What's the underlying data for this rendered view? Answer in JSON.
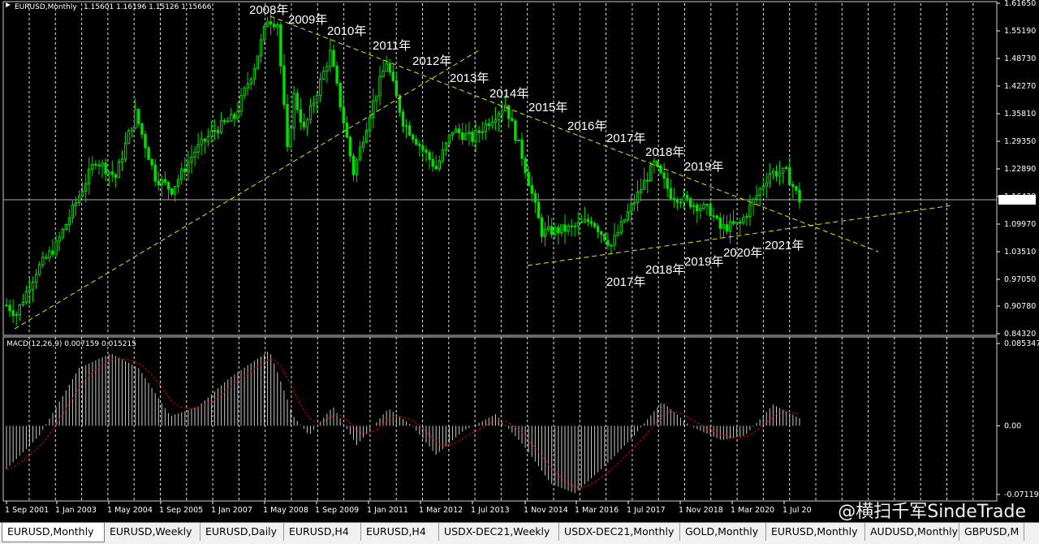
{
  "header": {
    "symbol_label": "EURUSD,Monthly",
    "ohlc": "1.15601 1.16196 1.15126 1.15666"
  },
  "price_axis": {
    "ticks": [
      "1.61650",
      "1.55190",
      "1.48730",
      "1.42270",
      "1.35810",
      "1.29350",
      "1.22890",
      "1.16430",
      "1.09970",
      "1.03510",
      "0.97050",
      "0.90780",
      "0.84320"
    ],
    "current_price": "1.15666"
  },
  "macd": {
    "label": "MACD(12,26,9) 0.007159 0.015215",
    "ticks": [
      "0.085347",
      "0.00",
      "-0.071197"
    ]
  },
  "time_axis": {
    "labels": [
      "1 Sep 2001",
      "1 Jan 2003",
      "1 May 2004",
      "1 Sep 2005",
      "1 Jan 2007",
      "1 May 2008",
      "1 Sep 2009",
      "1 Jan 2011",
      "1 Mar 2012",
      "1 Jul 2013",
      "1 Nov 2014",
      "1 Mar 2016",
      "1 Jul 2017",
      "1 Nov 2018",
      "1 Mar 2020",
      "1 Jul 20"
    ]
  },
  "annotations": {
    "upper_years": [
      "2008年",
      "2009年",
      "2010年",
      "2011年",
      "2012年",
      "2013年",
      "2014年",
      "2015年",
      "2016年",
      "2017年",
      "2018年",
      "2019年"
    ],
    "lower_years": [
      "2017年",
      "2018年",
      "2019年",
      "2020年",
      "2021年"
    ]
  },
  "watermark": "@横扫千军SindeTrade",
  "tabs": [
    {
      "label": "EURUSD,Monthly",
      "active": true
    },
    {
      "label": "EURUSD,Weekly",
      "active": false
    },
    {
      "label": "EURUSD,Daily",
      "active": false
    },
    {
      "label": "EURUSD,H4",
      "active": false
    },
    {
      "label": "EURUSD,H4",
      "active": false
    },
    {
      "label": "USDX-DEC21,Weekly",
      "active": false
    },
    {
      "label": "USDX-DEC21,Monthly",
      "active": false
    },
    {
      "label": "GOLD,Monthly",
      "active": false
    },
    {
      "label": "EURUSD,Monthly",
      "active": false
    },
    {
      "label": "AUDUSD,Monthly",
      "active": false
    },
    {
      "label": "GBPUSD,M",
      "active": false
    }
  ],
  "colors": {
    "background": "#000000",
    "candles": "#00e000",
    "trendlines": "#e8e800",
    "grid": "#ffffff",
    "macd_hist": "#c8c8c8",
    "macd_signal": "#e00000"
  },
  "chart_data": {
    "type": "candlestick",
    "symbol": "EURUSD",
    "timeframe": "Monthly",
    "price_range": [
      0.8432,
      1.6165
    ],
    "close_path": [
      [
        "2001-09",
        0.91
      ],
      [
        "2001-12",
        0.89
      ],
      [
        "2002-06",
        0.99
      ],
      [
        "2002-12",
        1.05
      ],
      [
        "2003-06",
        1.15
      ],
      [
        "2003-12",
        1.25
      ],
      [
        "2004-06",
        1.21
      ],
      [
        "2004-12",
        1.36
      ],
      [
        "2005-06",
        1.21
      ],
      [
        "2005-11",
        1.18
      ],
      [
        "2006-06",
        1.27
      ],
      [
        "2006-12",
        1.32
      ],
      [
        "2007-06",
        1.35
      ],
      [
        "2007-12",
        1.47
      ],
      [
        "2008-04",
        1.58
      ],
      [
        "2008-07",
        1.57
      ],
      [
        "2008-10",
        1.27
      ],
      [
        "2008-12",
        1.4
      ],
      [
        "2009-03",
        1.32
      ],
      [
        "2009-11",
        1.5
      ],
      [
        "2010-06",
        1.22
      ],
      [
        "2010-11",
        1.36
      ],
      [
        "2011-04",
        1.48
      ],
      [
        "2011-09",
        1.34
      ],
      [
        "2012-07",
        1.23
      ],
      [
        "2012-12",
        1.32
      ],
      [
        "2013-06",
        1.3
      ],
      [
        "2014-04",
        1.38
      ],
      [
        "2014-09",
        1.26
      ],
      [
        "2015-03",
        1.08
      ],
      [
        "2015-12",
        1.09
      ],
      [
        "2016-06",
        1.11
      ],
      [
        "2016-12",
        1.05
      ],
      [
        "2017-06",
        1.14
      ],
      [
        "2018-01",
        1.24
      ],
      [
        "2018-06",
        1.17
      ],
      [
        "2019-06",
        1.13
      ],
      [
        "2019-09",
        1.09
      ],
      [
        "2020-03",
        1.1
      ],
      [
        "2020-12",
        1.22
      ],
      [
        "2021-05",
        1.22
      ],
      [
        "2021-09",
        1.1567
      ]
    ]
  }
}
